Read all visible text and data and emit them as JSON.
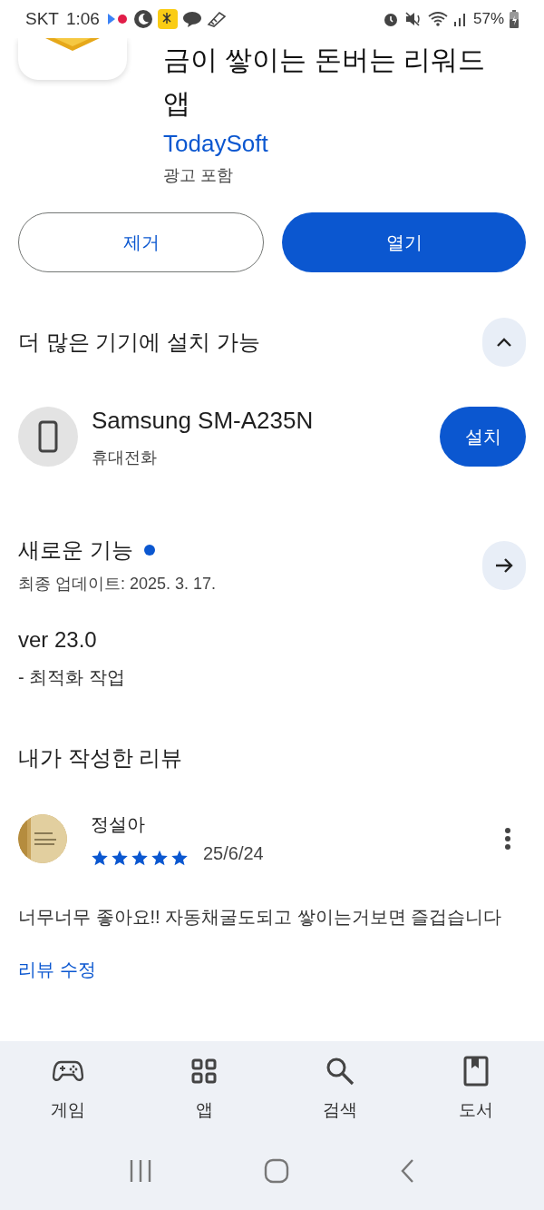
{
  "status_bar": {
    "carrier": "SKT",
    "time": "1:06",
    "battery": "57%"
  },
  "app": {
    "title": "금이 쌓이는 돈버는 리워드 앱",
    "developer": "TodaySoft",
    "ads_label": "광고 포함"
  },
  "actions": [
    {
      "label": "제거",
      "kind": "outlined"
    },
    {
      "label": "열기",
      "kind": "filled"
    }
  ],
  "devices": {
    "title": "더 많은 기기에 설치 가능",
    "expanded": true,
    "device": {
      "name": "Samsung SM-A235N",
      "type": "휴대전화",
      "button": "설치"
    }
  },
  "whats_new": {
    "title": "새로운 기능",
    "unread": true,
    "updated": "최종 업데이트: 2025. 3. 17.",
    "version": "ver 23.0",
    "notes": "- 최적화 작업"
  },
  "my_review": {
    "title": "내가 작성한 리뷰",
    "reviewer": "정설아",
    "stars": 5,
    "date": "25/6/24",
    "text": "너무너무 좋아요!! 자동채굴도되고 쌓이는거보면 즐겁습니다",
    "edit_link": "리뷰 수정"
  },
  "bottom_nav": [
    {
      "label": "게임",
      "kind": "games"
    },
    {
      "label": "앱",
      "kind": "apps"
    },
    {
      "label": "검색",
      "kind": "search"
    },
    {
      "label": "도서",
      "kind": "books"
    }
  ]
}
